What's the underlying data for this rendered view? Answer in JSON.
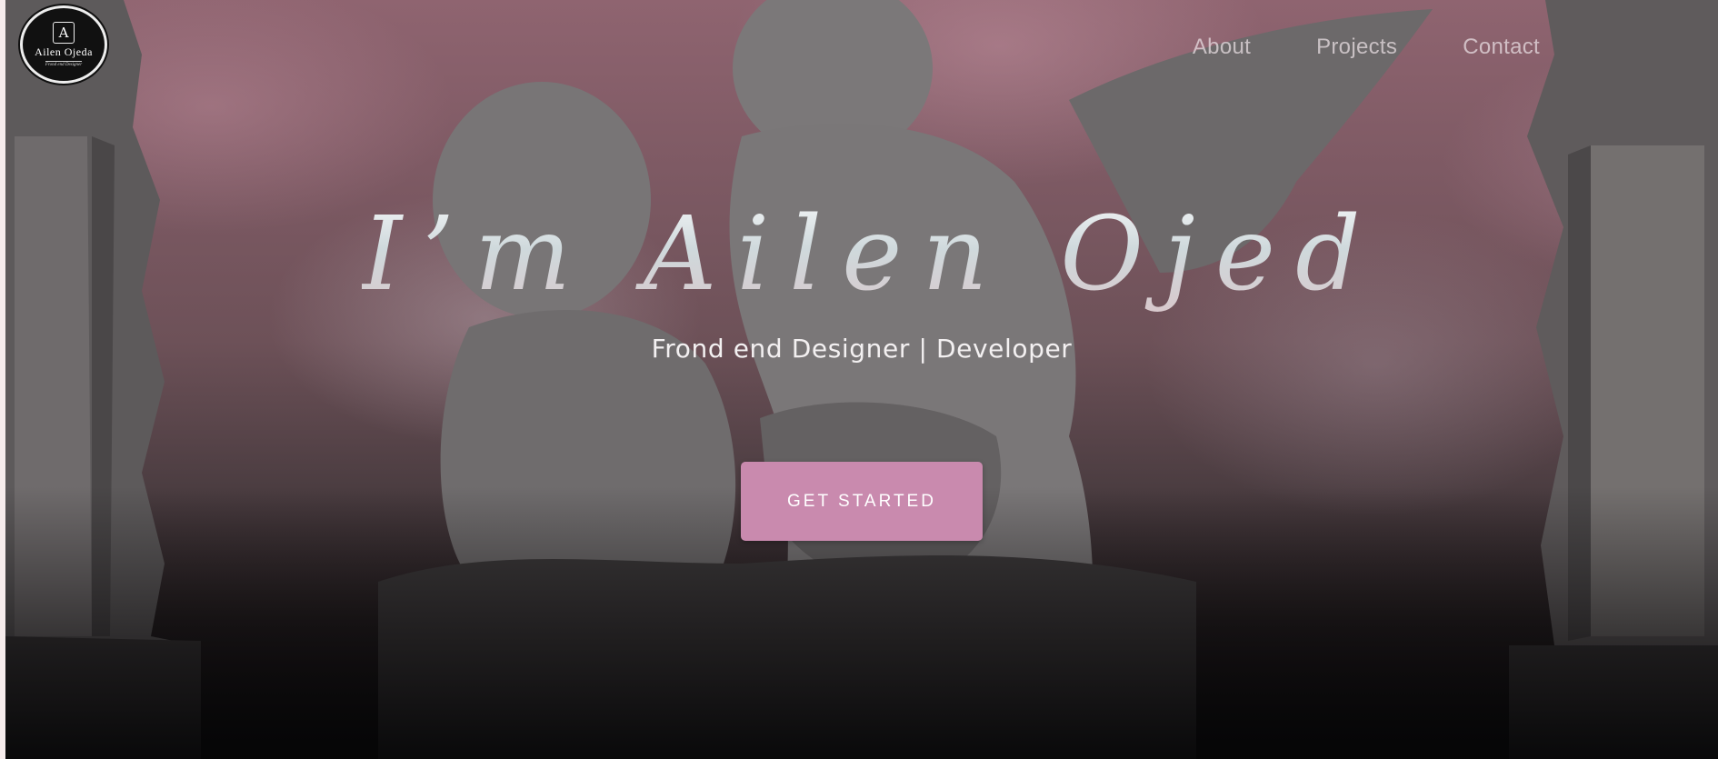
{
  "brand": {
    "logo_mark": "A",
    "logo_name": "Ailen Ojeda",
    "logo_tagline": "Frond end Designer"
  },
  "nav": {
    "items": [
      {
        "label": "About"
      },
      {
        "label": "Projects"
      },
      {
        "label": "Contact"
      }
    ]
  },
  "hero": {
    "title": "I’m Ailen Ojeda",
    "subtitle": "Frond end Designer | Developer",
    "cta_label": "GET STARTED"
  },
  "colors": {
    "accent": "#c98aae",
    "sky": "#8f6470",
    "text": "#f3f0f1"
  }
}
